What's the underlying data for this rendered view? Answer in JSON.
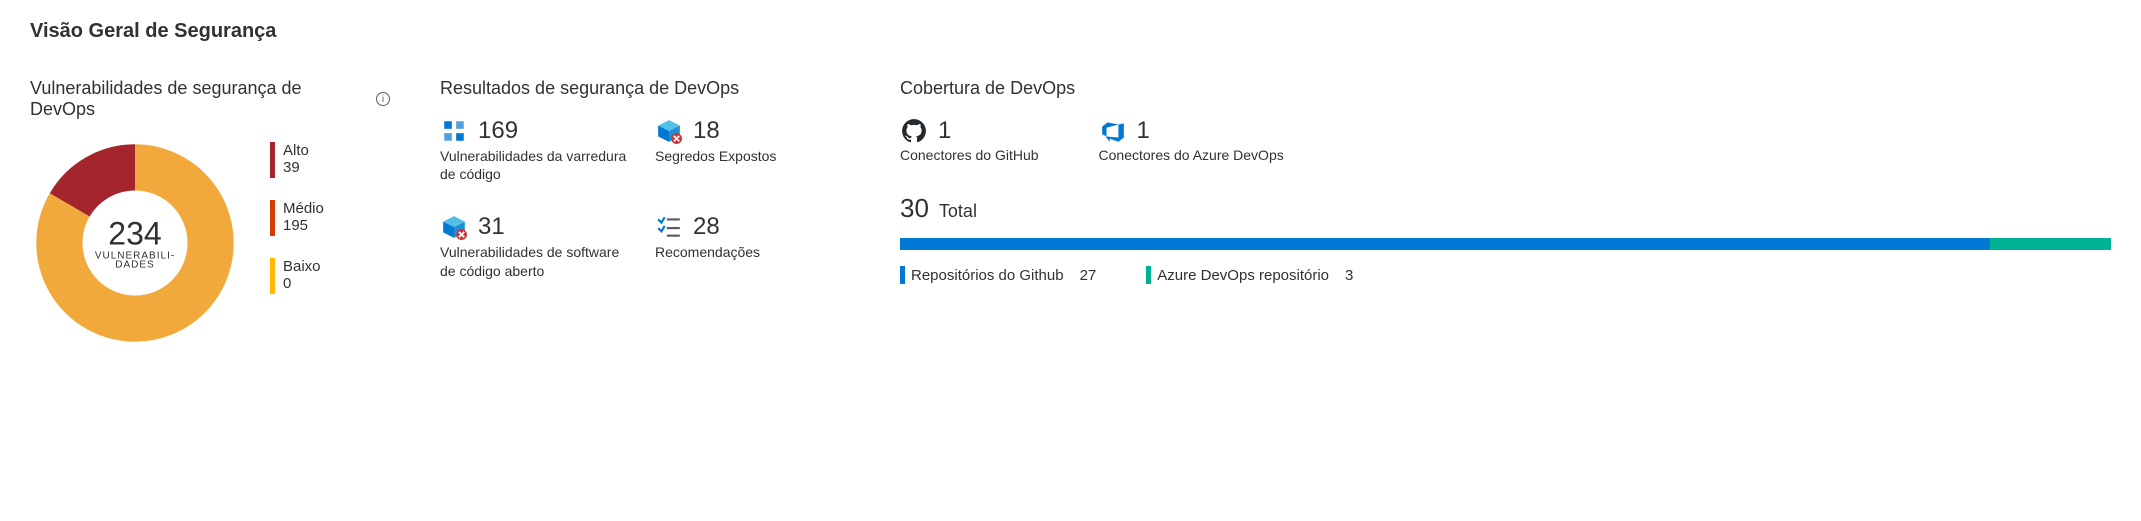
{
  "title": "Visão Geral de Segurança",
  "vuln": {
    "title": "Vulnerabilidades de segurança de DevOps",
    "total": "234",
    "total_label_line1": "VULNERABILI-",
    "total_label_line2": "DADES",
    "legend": {
      "high_label": "Alto",
      "high_value": "39",
      "high_color": "#a4262c",
      "medium_label": "Médio",
      "medium_value": "195",
      "medium_color": "#d83b01",
      "low_label": "Baixo",
      "low_value": "0",
      "low_color": "#ffb900"
    }
  },
  "results": {
    "title": "Resultados de segurança de DevOps",
    "code_scan": {
      "value": "169",
      "label": "Vulnerabilidades da varredura de código"
    },
    "secrets": {
      "value": "18",
      "label": "Segredos Expostos"
    },
    "oss": {
      "value": "31",
      "label": "Vulnerabilidades de software de código aberto"
    },
    "recs": {
      "value": "28",
      "label": "Recomendações"
    }
  },
  "coverage": {
    "title": "Cobertura de DevOps",
    "github": {
      "value": "1",
      "label": "Conectores do GitHub"
    },
    "azdo": {
      "value": "1",
      "label": "Conectores do Azure DevOps"
    },
    "total_value": "30",
    "total_label": "Total",
    "repos": {
      "github_label": "Repositórios do Github",
      "github_count": "27",
      "github_color": "#0078d4",
      "azdo_label": "Azure DevOps repositório",
      "azdo_count": "3",
      "azdo_color": "#00b294"
    }
  },
  "chart_data": [
    {
      "type": "pie",
      "title": "Vulnerabilidades de segurança de DevOps",
      "categories": [
        "Alto",
        "Médio",
        "Baixo"
      ],
      "values": [
        39,
        195,
        0
      ],
      "colors": [
        "#a4262c",
        "#f2a93b",
        "#ffb900"
      ],
      "center_label": "234 VULNERABILIDADES"
    },
    {
      "type": "bar",
      "title": "Cobertura de DevOps — repositórios",
      "categories": [
        "Repositórios do Github",
        "Azure DevOps repositório"
      ],
      "values": [
        27,
        3
      ],
      "colors": [
        "#0078d4",
        "#00b294"
      ],
      "total": 30
    }
  ]
}
